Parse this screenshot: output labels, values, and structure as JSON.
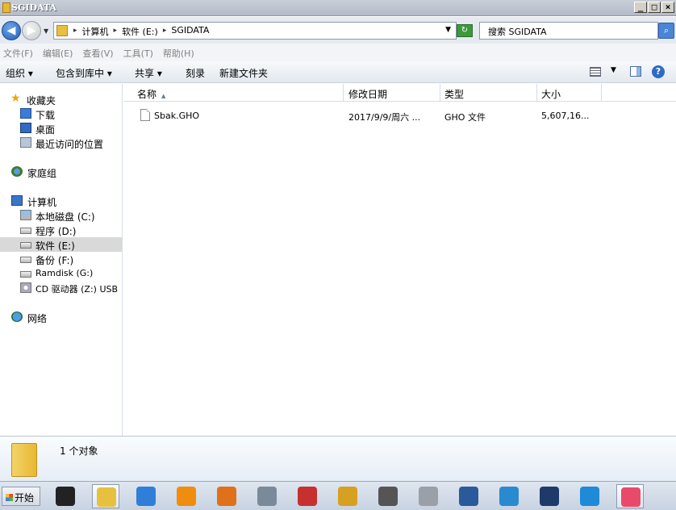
{
  "window": {
    "title": "SGIDATA",
    "controls": {
      "minimize": "_",
      "maximize": "□",
      "close": "×"
    }
  },
  "address": {
    "breadcrumbs": [
      "计算机",
      "软件 (E:)",
      "SGIDATA"
    ],
    "search_placeholder": "搜索 SGIDATA"
  },
  "menu": [
    "文件(F)",
    "编辑(E)",
    "查看(V)",
    "工具(T)",
    "帮助(H)"
  ],
  "toolbar": {
    "organize": "组织 ▾",
    "include_in_library": "包含到库中 ▾",
    "share": "共享 ▾",
    "burn": "刻录",
    "new_folder": "新建文件夹"
  },
  "nav": {
    "favorites": "收藏夹",
    "downloads": "下载",
    "desktop": "桌面",
    "recent": "最近访问的位置",
    "homegroup": "家庭组",
    "computer": "计算机",
    "drive_c": "本地磁盘 (C:)",
    "drive_d": "程序 (D:)",
    "drive_e": "软件 (E:)",
    "drive_f": "备份 (F:)",
    "drive_g": "Ramdisk (G:)",
    "drive_z": "CD 驱动器 (Z:) USB",
    "network": "网络"
  },
  "columns": {
    "name": "名称",
    "modified": "修改日期",
    "type": "类型",
    "size": "大小"
  },
  "files": [
    {
      "name": "Sbak.GHO",
      "modified": "2017/9/9/周六 ...",
      "type": "GHO 文件",
      "size": "5,607,16..."
    }
  ],
  "status": {
    "count": "1 个对象"
  },
  "taskbar": {
    "start": "开始",
    "apps": [
      {
        "icon": "qq-icon",
        "color": "#222222"
      },
      {
        "icon": "explorer-icon",
        "color": "#e8c040",
        "active": true
      },
      {
        "icon": "ie-icon",
        "color": "#2f7fd8"
      },
      {
        "icon": "app-orange-icon",
        "color": "#f08c10"
      },
      {
        "icon": "g-app-icon",
        "color": "#e0701a"
      },
      {
        "icon": "network-tool-icon",
        "color": "#7a8a9a"
      },
      {
        "icon": "record-icon",
        "color": "#c83030"
      },
      {
        "icon": "vpn-icon",
        "color": "#d8a020"
      },
      {
        "icon": "usb-tool-icon",
        "color": "#555555"
      },
      {
        "icon": "drive-icon",
        "color": "#9aa0a8"
      },
      {
        "icon": "monitor-icon",
        "color": "#2a5a9a"
      },
      {
        "icon": "globe-icon",
        "color": "#2a8ad0"
      },
      {
        "icon": "photoshop-icon",
        "color": "#1e3a6a"
      },
      {
        "icon": "s-app-icon",
        "color": "#1e8ad8"
      },
      {
        "icon": "camera-icon",
        "color": "#e84a6a",
        "active": true
      }
    ]
  }
}
